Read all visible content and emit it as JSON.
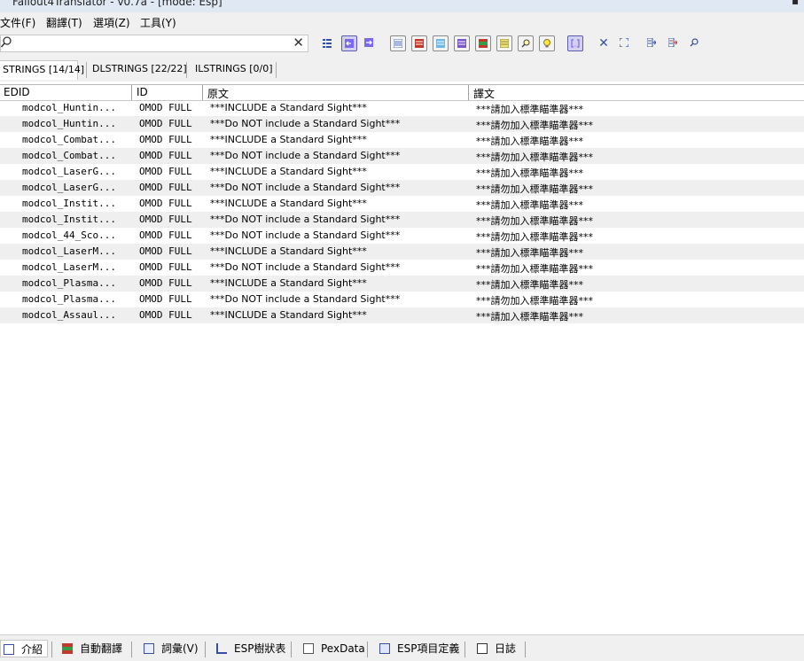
{
  "window": {
    "title": "Fallout4Translator - v0.7a - [mode: Esp]"
  },
  "menu": [
    "文件(F)",
    "翻譯(T)",
    "選項(Z)",
    "工具(Y)"
  ],
  "search": {
    "value": "",
    "placeholder": ""
  },
  "tabs": [
    "STRINGS [14/14]",
    "DLSTRINGS [22/22]",
    "ILSTRINGS [0/0]"
  ],
  "columns": {
    "edid": "EDID",
    "id": "ID",
    "source": "原文",
    "translation": "譯文"
  },
  "rows": [
    {
      "edid": "modcol_Huntin...",
      "id": "OMOD FULL",
      "source": "***INCLUDE a Standard Sight***",
      "translation": "***請加入標準瞄準器***"
    },
    {
      "edid": "modcol_Huntin...",
      "id": "OMOD FULL",
      "source": "***Do NOT include a Standard Sight***",
      "translation": "***請勿加入標準瞄準器***"
    },
    {
      "edid": "modcol_Combat...",
      "id": "OMOD FULL",
      "source": "***INCLUDE a Standard Sight***",
      "translation": "***請加入標準瞄準器***"
    },
    {
      "edid": "modcol_Combat...",
      "id": "OMOD FULL",
      "source": "***Do NOT include a Standard Sight***",
      "translation": "***請勿加入標準瞄準器***"
    },
    {
      "edid": "modcol_LaserG...",
      "id": "OMOD FULL",
      "source": "***INCLUDE a Standard Sight***",
      "translation": "***請加入標準瞄準器***"
    },
    {
      "edid": "modcol_LaserG...",
      "id": "OMOD FULL",
      "source": "***Do NOT include a Standard Sight***",
      "translation": "***請勿加入標準瞄準器***"
    },
    {
      "edid": "modcol_Instit...",
      "id": "OMOD FULL",
      "source": "***INCLUDE a Standard Sight***",
      "translation": "***請加入標準瞄準器***"
    },
    {
      "edid": "modcol_Instit...",
      "id": "OMOD FULL",
      "source": "***Do NOT include a Standard Sight***",
      "translation": "***請勿加入標準瞄準器***"
    },
    {
      "edid": "modcol_44_Sco...",
      "id": "OMOD FULL",
      "source": "***Do NOT include a Standard Sight***",
      "translation": "***請勿加入標準瞄準器***"
    },
    {
      "edid": "modcol_LaserM...",
      "id": "OMOD FULL",
      "source": "***INCLUDE a Standard Sight***",
      "translation": "***請加入標準瞄準器***"
    },
    {
      "edid": "modcol_LaserM...",
      "id": "OMOD FULL",
      "source": "***Do NOT include a Standard Sight***",
      "translation": "***請勿加入標準瞄準器***"
    },
    {
      "edid": "modcol_Plasma...",
      "id": "OMOD FULL",
      "source": "***INCLUDE a Standard Sight***",
      "translation": "***請加入標準瞄準器***"
    },
    {
      "edid": "modcol_Plasma...",
      "id": "OMOD FULL",
      "source": "***Do NOT include a Standard Sight***",
      "translation": "***請勿加入標準瞄準器***"
    },
    {
      "edid": "modcol_Assaul...",
      "id": "OMOD FULL",
      "source": "***INCLUDE a Standard Sight***",
      "translation": "***請加入標準瞄準器***"
    }
  ],
  "bottom_tabs": [
    "介紹",
    "自動翻譯",
    "詞彙(V)",
    "ESP樹狀表",
    "PexData",
    "ESP項目定義",
    "日誌"
  ],
  "icons": {
    "toolbar": [
      "grid-icon",
      "arrow-left-icon",
      "arrow-right-icon",
      "list-blue-icon",
      "list-red-icon",
      "list-cyan-icon",
      "list-purple-icon",
      "list-multicolor-icon",
      "list-yellow-icon",
      "find-icon",
      "lightbulb-icon",
      "brackets-icon",
      "close-icon",
      "expand-icon",
      "export-icon",
      "import-icon",
      "search-replace-icon"
    ],
    "status": [
      "info-icon",
      "auto-translate-icon",
      "vocabulary-icon",
      "tree-icon",
      "pex-icon",
      "definition-icon",
      "log-icon"
    ]
  },
  "colors": {
    "accent": "#7b68ee",
    "row_alt": "#efefef"
  }
}
